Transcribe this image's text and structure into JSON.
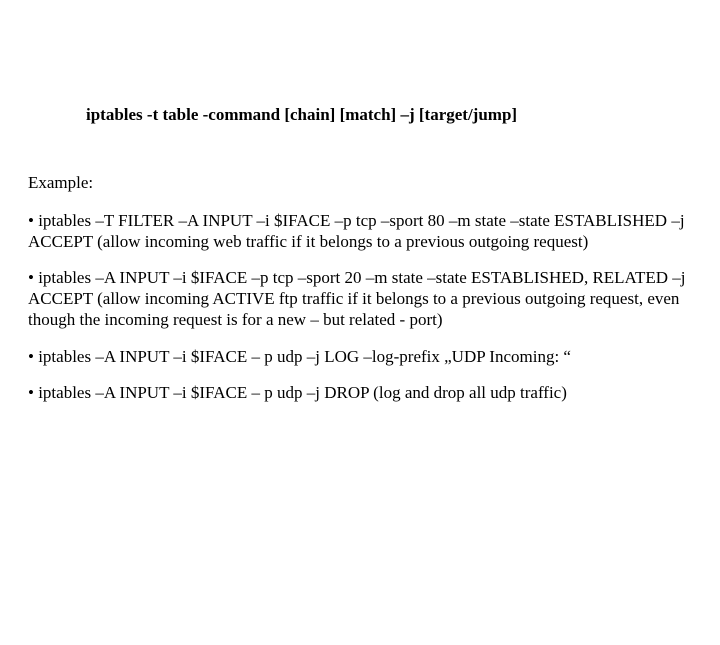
{
  "syntax": "iptables  -t table -command [chain]  [match] –j [target/jump]",
  "example_label": "Example:",
  "bullets": [
    "• iptables –T FILTER –A INPUT –i $IFACE –p tcp –sport 80 –m state –state ESTABLISHED –j ACCEPT (allow incoming web traffic if it belongs to a previous outgoing request)",
    "• iptables –A INPUT –i $IFACE –p tcp –sport 20 –m state –state ESTABLISHED, RELATED –j ACCEPT (allow incoming ACTIVE ftp traffic if it belongs to a previous outgoing request, even though the incoming request is for a new – but related - port)",
    "• iptables –A INPUT –i $IFACE – p udp –j LOG –log-prefix „UDP Incoming: “",
    "• iptables –A INPUT –i $IFACE – p udp –j DROP (log and drop all udp traffic)"
  ]
}
